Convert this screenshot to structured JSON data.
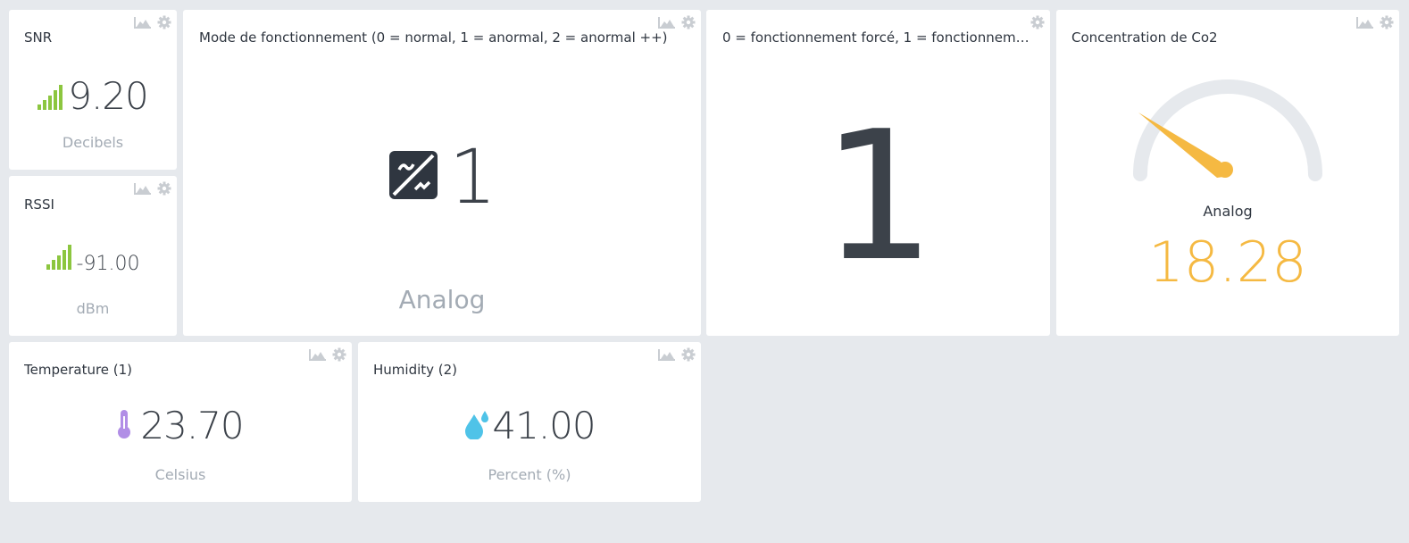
{
  "colors": {
    "background": "#e6e9ed",
    "card": "#ffffff",
    "signal_green": "#8cc63f",
    "gauge_orange": "#f5b942",
    "gauge_track": "#e6e9ed",
    "thermo_purple": "#b18ee6",
    "water_blue": "#4fc3e8",
    "tool_icon_gray": "#c9cdd2"
  },
  "widgets": {
    "snr": {
      "title": "SNR",
      "value": "9.20",
      "unit": "Decibels",
      "icon": "signal-bars-icon"
    },
    "rssi": {
      "title": "RSSI",
      "value": "-91.00",
      "unit": "dBm",
      "icon": "signal-bars-icon"
    },
    "mode": {
      "title": "Mode de fonctionnement (0 = normal, 1 = anormal, 2 = anormal ++)",
      "value": "1",
      "unit": "Analog",
      "icon": "analog-io-icon"
    },
    "forced": {
      "title": "0 = fonctionnement forcé, 1 = fonctionnemen...",
      "value": "1"
    },
    "co2": {
      "title": "Concentration de Co2",
      "gauge_label": "Analog",
      "value": "18.28",
      "icon": "gauge-icon"
    },
    "temperature": {
      "title": "Temperature (1)",
      "value": "23.70",
      "unit": "Celsius",
      "icon": "thermometer-icon"
    },
    "humidity": {
      "title": "Humidity (2)",
      "value": "41.00",
      "unit": "Percent (%)",
      "icon": "water-drops-icon"
    }
  }
}
